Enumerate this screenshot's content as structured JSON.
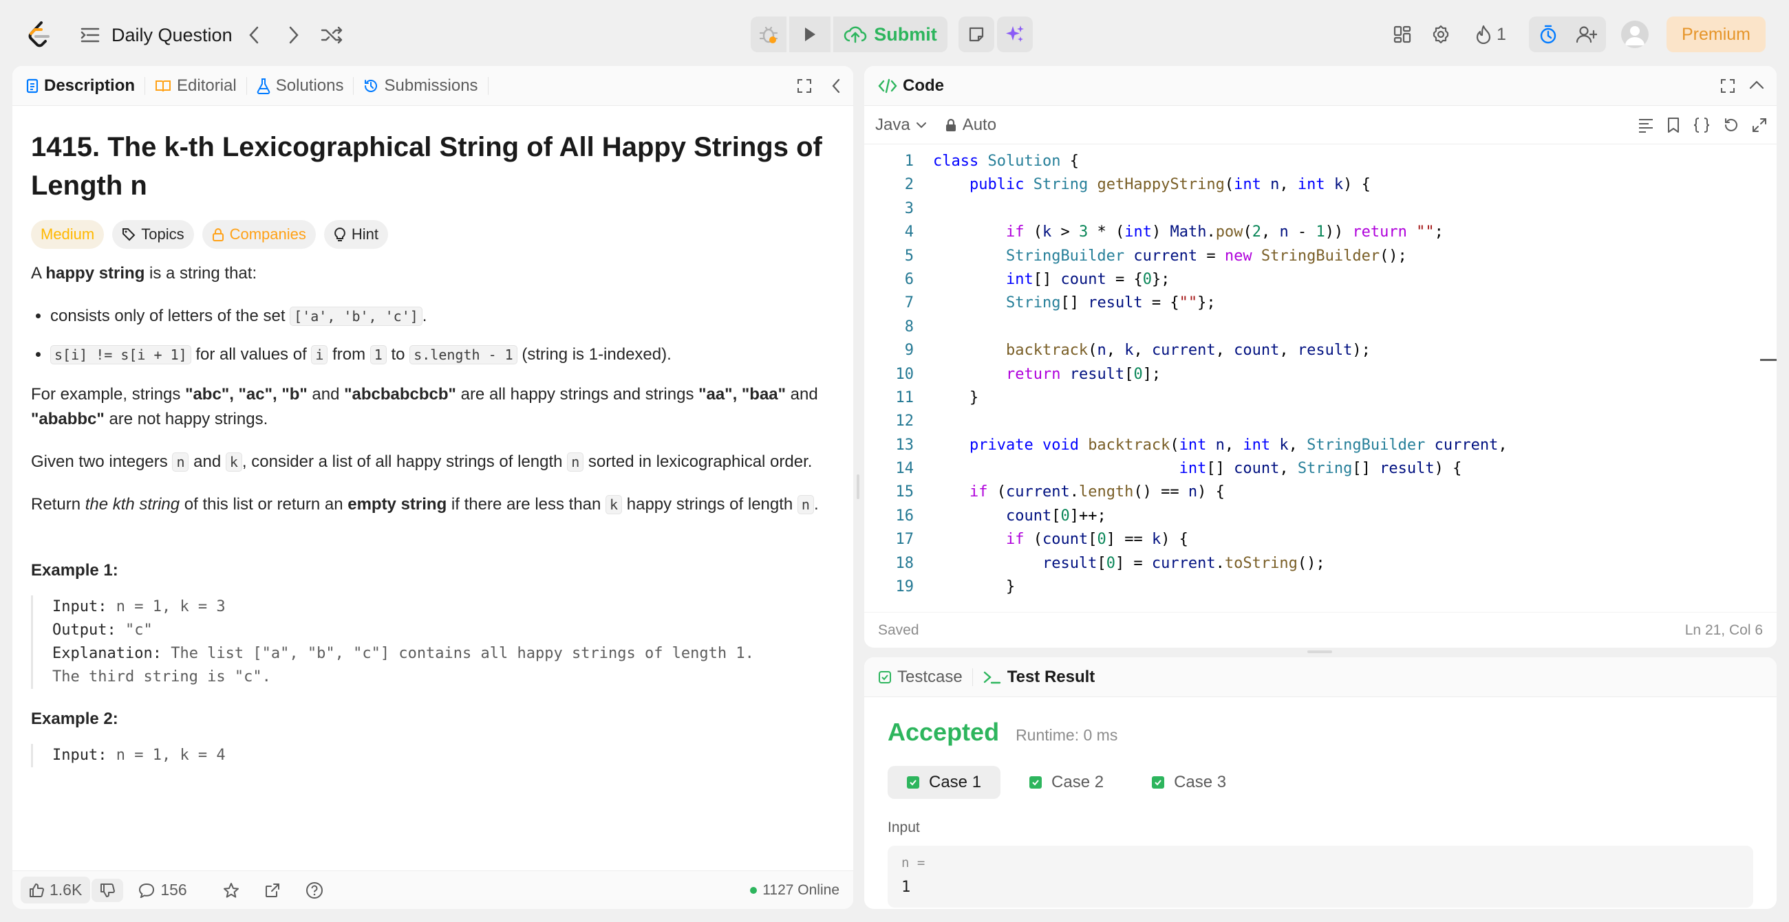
{
  "topbar": {
    "daily_label": "Daily Question",
    "submit_label": "Submit",
    "streak_count": "1",
    "premium_label": "Premium"
  },
  "left_tabs": [
    {
      "label": "Description",
      "icon": "document-icon"
    },
    {
      "label": "Editorial",
      "icon": "book-icon"
    },
    {
      "label": "Solutions",
      "icon": "flask-icon"
    },
    {
      "label": "Submissions",
      "icon": "history-icon"
    }
  ],
  "problem": {
    "title": "1415. The k-th Lexicographical String of All Happy Strings of Length n",
    "difficulty": "Medium",
    "topics_label": "Topics",
    "companies_label": "Companies",
    "hint_label": "Hint",
    "p1_pre": "A ",
    "p1_bold": "happy string",
    "p1_post": " is a string that:",
    "b1_pre": "consists only of letters of the set ",
    "b1_code": "['a', 'b', 'c']",
    "b1_post": ".",
    "b2_code1": "s[i] != s[i + 1]",
    "b2_mid1": " for all values of ",
    "b2_code2": "i",
    "b2_mid2": " from ",
    "b2_code3": "1",
    "b2_mid3": " to ",
    "b2_code4": "s.length - 1",
    "b2_post": " (string is 1-indexed).",
    "p2_a": "For example, strings ",
    "p2_b": "\"abc\", \"ac\", \"b\"",
    "p2_c": " and ",
    "p2_d": "\"abcbabcbcb\"",
    "p2_e": " are all happy strings and strings ",
    "p2_f": "\"aa\", \"baa\"",
    "p2_g": " and ",
    "p2_h": "\"ababbc\"",
    "p2_i": " are not happy strings.",
    "p3_a": "Given two integers ",
    "p3_n": "n",
    "p3_b": " and ",
    "p3_k": "k",
    "p3_c": ", consider a list of all happy strings of length ",
    "p3_n2": "n",
    "p3_d": " sorted in lexicographical order.",
    "p4_a": "Return ",
    "p4_b": "the kth string",
    "p4_c": " of this list or return an ",
    "p4_d": "empty string",
    "p4_e": " if there are less than ",
    "p4_k": "k",
    "p4_f": " happy strings of length ",
    "p4_n": "n",
    "p4_g": ".",
    "ex1_title": "Example 1:",
    "ex1_input_label": "Input:",
    "ex1_input": " n = 1, k = 3",
    "ex1_output_label": "Output:",
    "ex1_output": " \"c\"",
    "ex1_expl_label": "Explanation:",
    "ex1_expl": " The list [\"a\", \"b\", \"c\"] contains all happy strings of length 1.",
    "ex1_expl2": "The third string is \"c\".",
    "ex2_title": "Example 2:",
    "ex2_input_label": "Input:",
    "ex2_input": " n = 1, k = 4"
  },
  "footer": {
    "likes": "1.6K",
    "comments": "156",
    "online": "1127 Online"
  },
  "code": {
    "panel_title": "Code",
    "language": "Java",
    "mode": "Auto",
    "status_saved": "Saved",
    "cursor": "Ln 21, Col 6"
  },
  "result": {
    "tab_testcase": "Testcase",
    "tab_result": "Test Result",
    "verdict": "Accepted",
    "runtime": "Runtime: 0 ms",
    "cases": [
      "Case 1",
      "Case 2",
      "Case 3"
    ],
    "input_label": "Input",
    "var_label": "n =",
    "var_value": "1"
  }
}
